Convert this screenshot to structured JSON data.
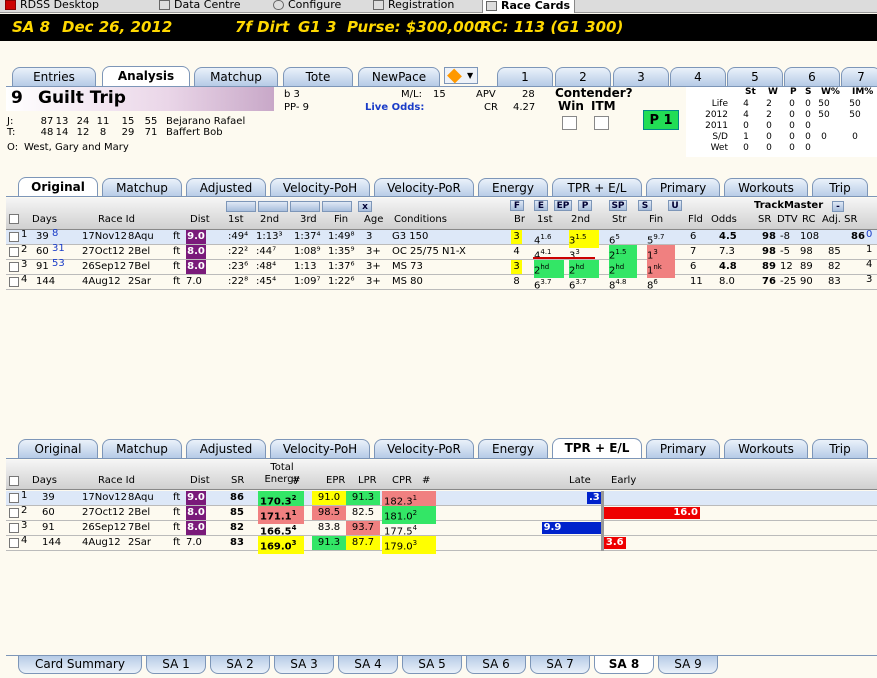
{
  "topnav": {
    "tabs": [
      {
        "label": "RDSS Desktop"
      },
      {
        "label": "Data Centre"
      },
      {
        "label": "Configure"
      },
      {
        "label": "Registration"
      },
      {
        "label": "Race Cards"
      }
    ]
  },
  "race_header": {
    "track_num": "SA  8",
    "date": "Dec 26, 2012",
    "distance": "7f  Dirt",
    "grade": "G1  3",
    "purse": "Purse: $300,000",
    "rc": "RC: 113  (G1 300)"
  },
  "main_tabs": [
    "Entries",
    "Analysis",
    "Matchup",
    "Tote",
    "NewPace",
    "1",
    "2",
    "3",
    "4",
    "5",
    "6",
    "7"
  ],
  "horse": {
    "number": "9",
    "name": "Guilt Trip",
    "sex_color": "b 3",
    "pp": "PP- 9",
    "ml_label": "M/L:",
    "ml": "15",
    "apv_label": "APV",
    "apv": "28",
    "live_odds": "Live Odds:",
    "cr_label": "CR",
    "cr": "4.27",
    "contender_label": "Contender?",
    "win_label": "Win",
    "itm_label": "ITM",
    "p1": "P 1",
    "jockey_label": "J:",
    "jockey_stats": [
      "87",
      "13",
      "24",
      "11",
      "15",
      "55"
    ],
    "jockey_name": "Bejarano Rafael",
    "trainer_label": "T:",
    "trainer_stats": [
      "48",
      "14",
      "12",
      "8",
      "29",
      "71"
    ],
    "trainer_name": "Baffert Bob",
    "owner_label": "O:",
    "owner": "West, Gary and Mary"
  },
  "record": {
    "headers": [
      "St",
      "W",
      "P",
      "S",
      "W%",
      "IM%"
    ],
    "rows": [
      {
        "label": "Life",
        "vals": [
          "4",
          "2",
          "0",
          "0",
          "50",
          "50"
        ]
      },
      {
        "label": "2012",
        "vals": [
          "4",
          "2",
          "0",
          "0",
          "50",
          "50"
        ]
      },
      {
        "label": "2011",
        "vals": [
          "0",
          "0",
          "0",
          "0",
          "",
          ""
        ]
      },
      {
        "label": "S/D",
        "vals": [
          "1",
          "0",
          "0",
          "0",
          "0",
          "0"
        ]
      },
      {
        "label": "Wet",
        "vals": [
          "0",
          "0",
          "0",
          "0",
          "",
          ""
        ]
      }
    ]
  },
  "sub_tabs": [
    "Original",
    "Matchup",
    "Adjusted",
    "Velocity-PoH",
    "Velocity-PoR",
    "Energy",
    "TPR + E/L",
    "Primary",
    "Workouts",
    "Trip"
  ],
  "pp_table": {
    "filter_buttons": [
      "F",
      "E",
      "EP",
      "P",
      "SP",
      "S",
      "U"
    ],
    "trackmaster": "TrackMaster",
    "headers": {
      "days": "Days",
      "race_id": "Race Id",
      "dist": "Dist",
      "c1st": "1st",
      "c2nd": "2nd",
      "c3rd": "3rd",
      "fin": "Fin",
      "age": "Age",
      "conditions": "Conditions",
      "br": "Br",
      "p1st": "1st",
      "p2nd": "2nd",
      "str": "Str",
      "pfin": "Fin",
      "fld": "Fld",
      "odds": "Odds",
      "sr": "SR",
      "dtv": "DTV",
      "rc": "RC",
      "adjsr": "Adj. SR"
    },
    "rows": [
      {
        "idx": "1",
        "days": "39",
        "days_sup": "8",
        "date": "17Nov12",
        "race": "8Aqu",
        "surf": "ft",
        "dist": "9.0",
        "f1": ":49⁴",
        "f2": "1:13³",
        "f3": "1:37⁴",
        "fin": "1:49⁸",
        "age": "3",
        "cond": "G3 150",
        "br": "3",
        "c1": "4",
        "c1s": "1.6",
        "c2": "3",
        "c2s": "1.5",
        "str": "6",
        "strs": "5",
        "fn": "5",
        "fns": "9.7",
        "fld": "6",
        "odds": "4.5",
        "sr": "98",
        "dtv": "-8",
        "rc": "108",
        "adj": "86",
        "adjs": "0"
      },
      {
        "idx": "2",
        "days": "60",
        "days_sup": "31",
        "date": "27Oct12",
        "race": "2Bel",
        "surf": "ft",
        "dist": "8.0",
        "f1": ":22²",
        "f2": ":44⁷",
        "f3": "1:08⁹",
        "fin": "1:35⁹",
        "age": "3+",
        "cond": "OC 25/75 N1-X",
        "br": "4",
        "c1": "4",
        "c1s": "4.1",
        "c2": "3",
        "c2s": "3",
        "str": "2",
        "strs": "1.5",
        "fn": "1",
        "fns": "3",
        "fld": "7",
        "odds": "7.3",
        "sr": "98",
        "dtv": "-5",
        "rc": "98",
        "adj": "85",
        "adjs": "1"
      },
      {
        "idx": "3",
        "days": "91",
        "days_sup": "53",
        "date": "26Sep12",
        "race": "7Bel",
        "surf": "ft",
        "dist": "8.0",
        "f1": ":23⁶",
        "f2": ":48⁴",
        "f3": "1:13",
        "fin": "1:37⁶",
        "age": "3+",
        "cond": "MS 73",
        "br": "3",
        "c1": "2",
        "c1s": "hd",
        "c2": "2",
        "c2s": "hd",
        "str": "2",
        "strs": "hd",
        "fn": "1",
        "fns": "nk",
        "fld": "6",
        "odds": "4.8",
        "sr": "89",
        "dtv": "12",
        "rc": "89",
        "adj": "82",
        "adjs": "4"
      },
      {
        "idx": "4",
        "days": "144",
        "days_sup": "",
        "date": "4Aug12",
        "race": "2Sar",
        "surf": "ft",
        "dist": "7.0",
        "f1": ":22⁸",
        "f2": ":45⁴",
        "f3": "1:09⁷",
        "fin": "1:22⁶",
        "age": "3+",
        "cond": "MS 80",
        "br": "8",
        "c1": "6",
        "c1s": "3.7",
        "c2": "6",
        "c2s": "3.7",
        "str": "8",
        "strs": "4.8",
        "fn": "8",
        "fns": "6",
        "fld": "11",
        "odds": "8.0",
        "sr": "76",
        "dtv": "-25",
        "rc": "90",
        "adj": "83",
        "adjs": "3"
      }
    ]
  },
  "energy_table": {
    "headers": {
      "days": "Days",
      "race_id": "Race Id",
      "dist": "Dist",
      "sr": "SR",
      "total_energy": "Total Energy",
      "hash": "#",
      "epr": "EPR",
      "lpr": "LPR",
      "cpr": "CPR",
      "hash2": "#",
      "late": "Late",
      "early": "Early"
    },
    "rows": [
      {
        "idx": "1",
        "days": "39",
        "date": "17Nov12",
        "race": "8Aqu",
        "surf": "ft",
        "dist": "9.0",
        "sr": "86",
        "te": "170.3",
        "ter": "2",
        "epr": "91.0",
        "lpr": "91.3",
        "cpr": "182.3",
        "cprr": "1",
        "bar_value": ".3",
        "bar_side": "late",
        "bar_mag": 0.3
      },
      {
        "idx": "2",
        "days": "60",
        "date": "27Oct12",
        "race": "2Bel",
        "surf": "ft",
        "dist": "8.0",
        "sr": "85",
        "te": "171.1",
        "ter": "1",
        "epr": "98.5",
        "lpr": "82.5",
        "cpr": "181.0",
        "cprr": "2",
        "bar_value": "16.0",
        "bar_side": "early",
        "bar_mag": 16.0
      },
      {
        "idx": "3",
        "days": "91",
        "date": "26Sep12",
        "race": "7Bel",
        "surf": "ft",
        "dist": "8.0",
        "sr": "82",
        "te": "166.5",
        "ter": "4",
        "epr": "83.8",
        "lpr": "93.7",
        "cpr": "177.5",
        "cprr": "4",
        "bar_value": "9.9",
        "bar_side": "late",
        "bar_mag": 9.9
      },
      {
        "idx": "4",
        "days": "144",
        "date": "4Aug12",
        "race": "2Sar",
        "surf": "ft",
        "dist": "7.0",
        "sr": "83",
        "te": "169.0",
        "ter": "3",
        "epr": "91.3",
        "lpr": "87.7",
        "cpr": "179.0",
        "cprr": "3",
        "bar_value": "3.6",
        "bar_side": "early",
        "bar_mag": 3.6
      }
    ]
  },
  "bottom_tabs": [
    "Card Summary",
    "SA 1",
    "SA 2",
    "SA 3",
    "SA 4",
    "SA 5",
    "SA 6",
    "SA 7",
    "SA 8",
    "SA 9"
  ],
  "colors": {
    "yellow": "#ffff00",
    "green": "#33e666",
    "red": "#f08080",
    "purple": "#7a1a7a",
    "late_bar": "#0022cc",
    "early_bar": "#ee0000"
  }
}
